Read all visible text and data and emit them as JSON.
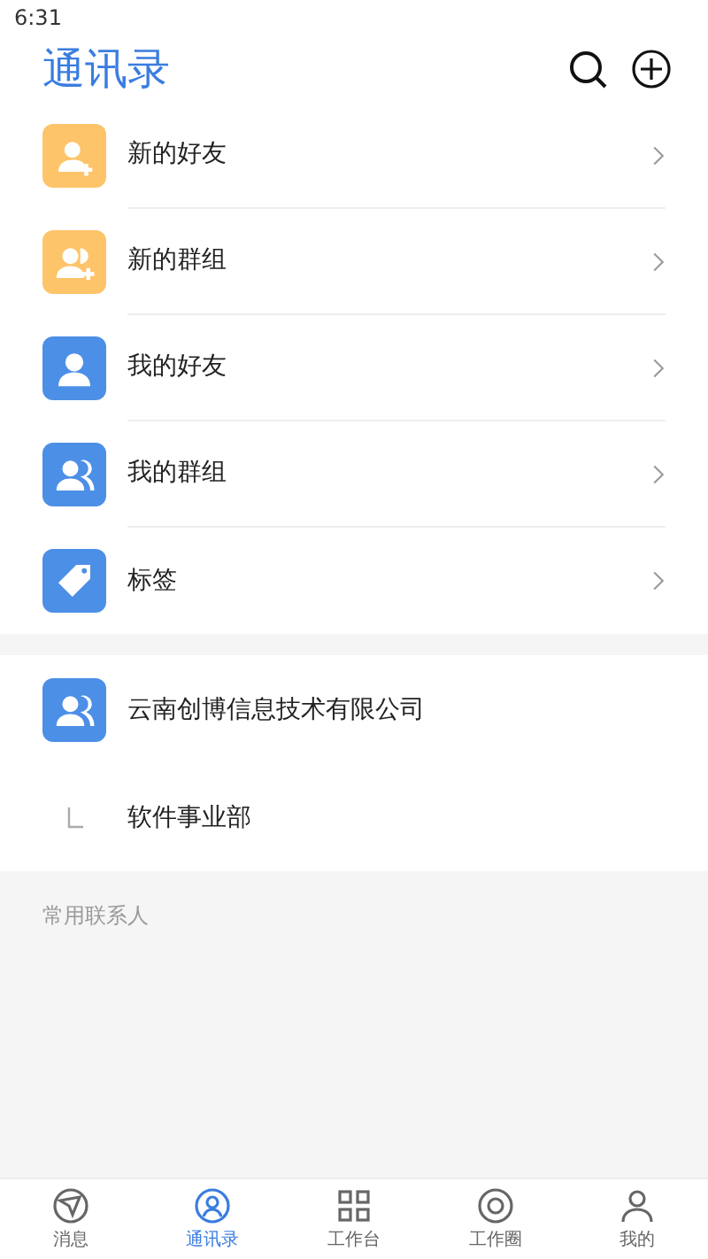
{
  "status_bar": {
    "time": "6:31"
  },
  "header": {
    "title": "通讯录"
  },
  "menu": [
    {
      "label": "新的好友",
      "kind": "add-person",
      "color": "#fdc46a"
    },
    {
      "label": "新的群组",
      "kind": "add-group",
      "color": "#fdc46a"
    },
    {
      "label": "我的好友",
      "kind": "person",
      "color": "#4c8fe6"
    },
    {
      "label": "我的群组",
      "kind": "group",
      "color": "#4c8fe6"
    },
    {
      "label": "标签",
      "kind": "tag",
      "color": "#4c8fe6"
    }
  ],
  "organization": {
    "name": "云南创博信息技术有限公司",
    "departments": [
      {
        "name": "软件事业部"
      }
    ]
  },
  "frequent_contacts": {
    "title": "常用联系人"
  },
  "tab_bar": [
    {
      "label": "消息",
      "kind": "message",
      "selected": false
    },
    {
      "label": "通讯录",
      "kind": "contacts",
      "selected": true
    },
    {
      "label": "工作台",
      "kind": "grid",
      "selected": false
    },
    {
      "label": "工作圈",
      "kind": "circle",
      "selected": false
    },
    {
      "label": "我的",
      "kind": "me",
      "selected": false
    }
  ]
}
